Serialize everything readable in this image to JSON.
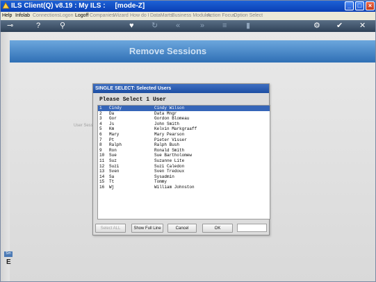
{
  "window": {
    "title": "ILS Client(Q) v8.19 : My ILS :     [mode-Z]"
  },
  "menubar": {
    "items": [
      {
        "label": "Help",
        "enabled": true
      },
      {
        "label": "Infolab",
        "enabled": true
      },
      {
        "label": "Connections",
        "enabled": false
      },
      {
        "label": "Logon",
        "enabled": false
      },
      {
        "label": "Logoff",
        "enabled": true
      },
      {
        "label": "Companies",
        "enabled": false
      },
      {
        "label": "Wizard",
        "enabled": false
      },
      {
        "label": "How do I",
        "enabled": false
      },
      {
        "label": "DataMarts",
        "enabled": false
      },
      {
        "label": "Business Modules",
        "enabled": false
      },
      {
        "label": "Action Focus",
        "enabled": false
      },
      {
        "label": "Option Select",
        "enabled": false
      }
    ]
  },
  "toolbar": {
    "icons": [
      "key-icon",
      "help-icon",
      "search-icon",
      "heart-icon",
      "refresh-icon",
      "back-icon",
      "forward-icon",
      "list-icon",
      "page-icon",
      "settings-icon",
      "check-icon",
      "close-icon"
    ]
  },
  "main": {
    "banner_title": "Remove Sessions",
    "background_label": "User Sessi",
    "bottom_tab": "Sm",
    "bottom_glyph": "E"
  },
  "dialog": {
    "title": "SINGLE SELECT: Selected Users",
    "prompt": "Please Select 1 User",
    "rows": [
      {
        "num": "1",
        "code": "Cindy",
        "name": "Cindy Wilson",
        "selected": true
      },
      {
        "num": "2",
        "code": "Da",
        "name": "Data Mngr",
        "selected": false
      },
      {
        "num": "3",
        "code": "Gor",
        "name": "Gordon Blomeau",
        "selected": false
      },
      {
        "num": "4",
        "code": "Js",
        "name": "John Smith",
        "selected": false
      },
      {
        "num": "5",
        "code": "Km",
        "name": "Kelvin Markgraaff",
        "selected": false
      },
      {
        "num": "6",
        "code": "Mary",
        "name": "Mary Pearson",
        "selected": false
      },
      {
        "num": "7",
        "code": "Pt",
        "name": "Pieter Visser",
        "selected": false
      },
      {
        "num": "8",
        "code": "Ralph",
        "name": "Ralph Bush",
        "selected": false
      },
      {
        "num": "9",
        "code": "Ron",
        "name": "Ronald Smith",
        "selected": false
      },
      {
        "num": "10",
        "code": "Sue",
        "name": "Sue Bartholomew",
        "selected": false
      },
      {
        "num": "11",
        "code": "Suz",
        "name": "Suzanne Lite",
        "selected": false
      },
      {
        "num": "12",
        "code": "Suzi",
        "name": "Suzi Caledon",
        "selected": false
      },
      {
        "num": "13",
        "code": "Sven",
        "name": "Sven Tredoux",
        "selected": false
      },
      {
        "num": "14",
        "code": "Sa",
        "name": "Sysadmin",
        "selected": false
      },
      {
        "num": "15",
        "code": "Tt",
        "name": "Tommy",
        "selected": false
      },
      {
        "num": "16",
        "code": "Wj",
        "name": "William Johnston",
        "selected": false
      }
    ],
    "buttons": {
      "select_all": "Select ALL",
      "show_full_line": "Show Full Line",
      "cancel": "Cancel",
      "ok": "OK"
    },
    "search_value": ""
  }
}
